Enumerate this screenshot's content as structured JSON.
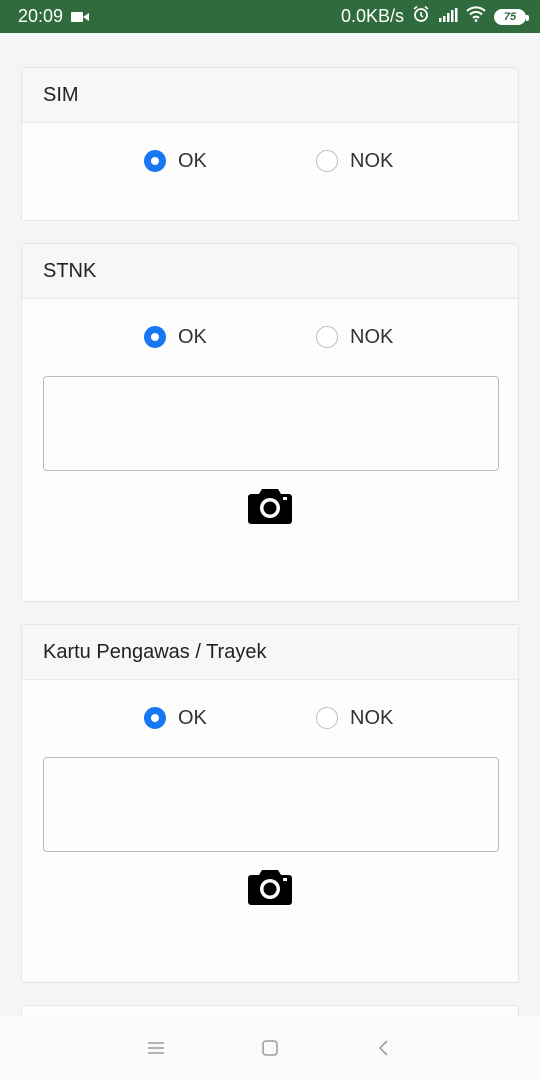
{
  "status_bar": {
    "time": "20:09",
    "network_speed": "0.0KB/s",
    "battery": "75",
    "background": "#2f6b3c"
  },
  "sections": [
    {
      "title": "SIM",
      "options": [
        "OK",
        "NOK"
      ],
      "selected": "OK",
      "has_note": false,
      "has_camera": false
    },
    {
      "title": "STNK",
      "options": [
        "OK",
        "NOK"
      ],
      "selected": "OK",
      "note_value": "",
      "has_note": true,
      "has_camera": true
    },
    {
      "title": "Kartu Pengawas / Trayek",
      "options": [
        "OK",
        "NOK"
      ],
      "selected": "OK",
      "note_value": "",
      "has_note": true,
      "has_camera": true
    }
  ],
  "icons": {
    "camera": "camera-icon",
    "menu": "menu-icon",
    "home": "home-icon",
    "back": "back-icon"
  },
  "colors": {
    "accent": "#1877f2",
    "status_bar": "#2f6b3c"
  }
}
